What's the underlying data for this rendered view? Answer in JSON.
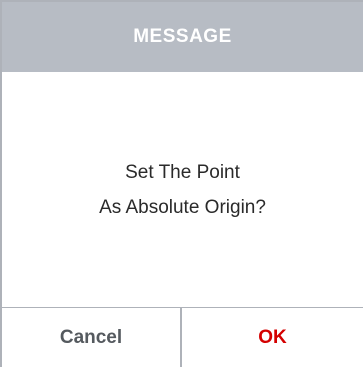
{
  "dialog": {
    "title": "MESSAGE",
    "message_lines": [
      "Set The Point",
      "As Absolute Origin?"
    ],
    "buttons": {
      "cancel_label": "Cancel",
      "ok_label": "OK"
    }
  },
  "colors": {
    "header_background": "#b7bcc4",
    "header_text": "#ffffff",
    "cancel_text": "#555a5f",
    "ok_text": "#d40000",
    "border": "#aeb2b9"
  }
}
